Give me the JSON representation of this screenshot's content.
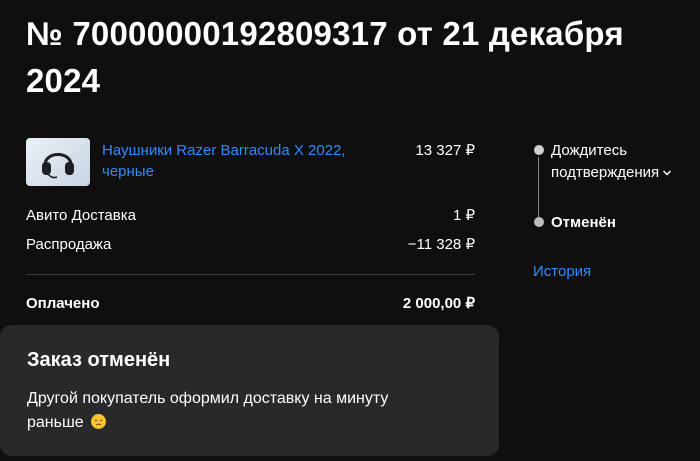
{
  "order": {
    "title": "№ 70000000192809317 от 21 декабря 2024"
  },
  "item": {
    "name": "Наушники Razer Barracuda X 2022, черные",
    "price": "13 327 ₽",
    "image_icon": "headphones-icon"
  },
  "lines": {
    "delivery_label": "Авито Доставка",
    "delivery_value": "1 ₽",
    "sale_label": "Распродажа",
    "sale_value": "−11 328 ₽",
    "total_label": "Оплачено",
    "total_value": "2 000,00 ₽"
  },
  "status": {
    "step1": "Дождитесь подтверждения",
    "step2": "Отменён",
    "history_link": "История"
  },
  "cancel": {
    "title": "Заказ отменён",
    "text": "Другой покупатель оформил доставку на минуту раньше",
    "emoji_icon": "disappointed-face-icon"
  },
  "colors": {
    "background": "#0f0f10",
    "card": "#29292b",
    "link": "#2f8cff"
  }
}
